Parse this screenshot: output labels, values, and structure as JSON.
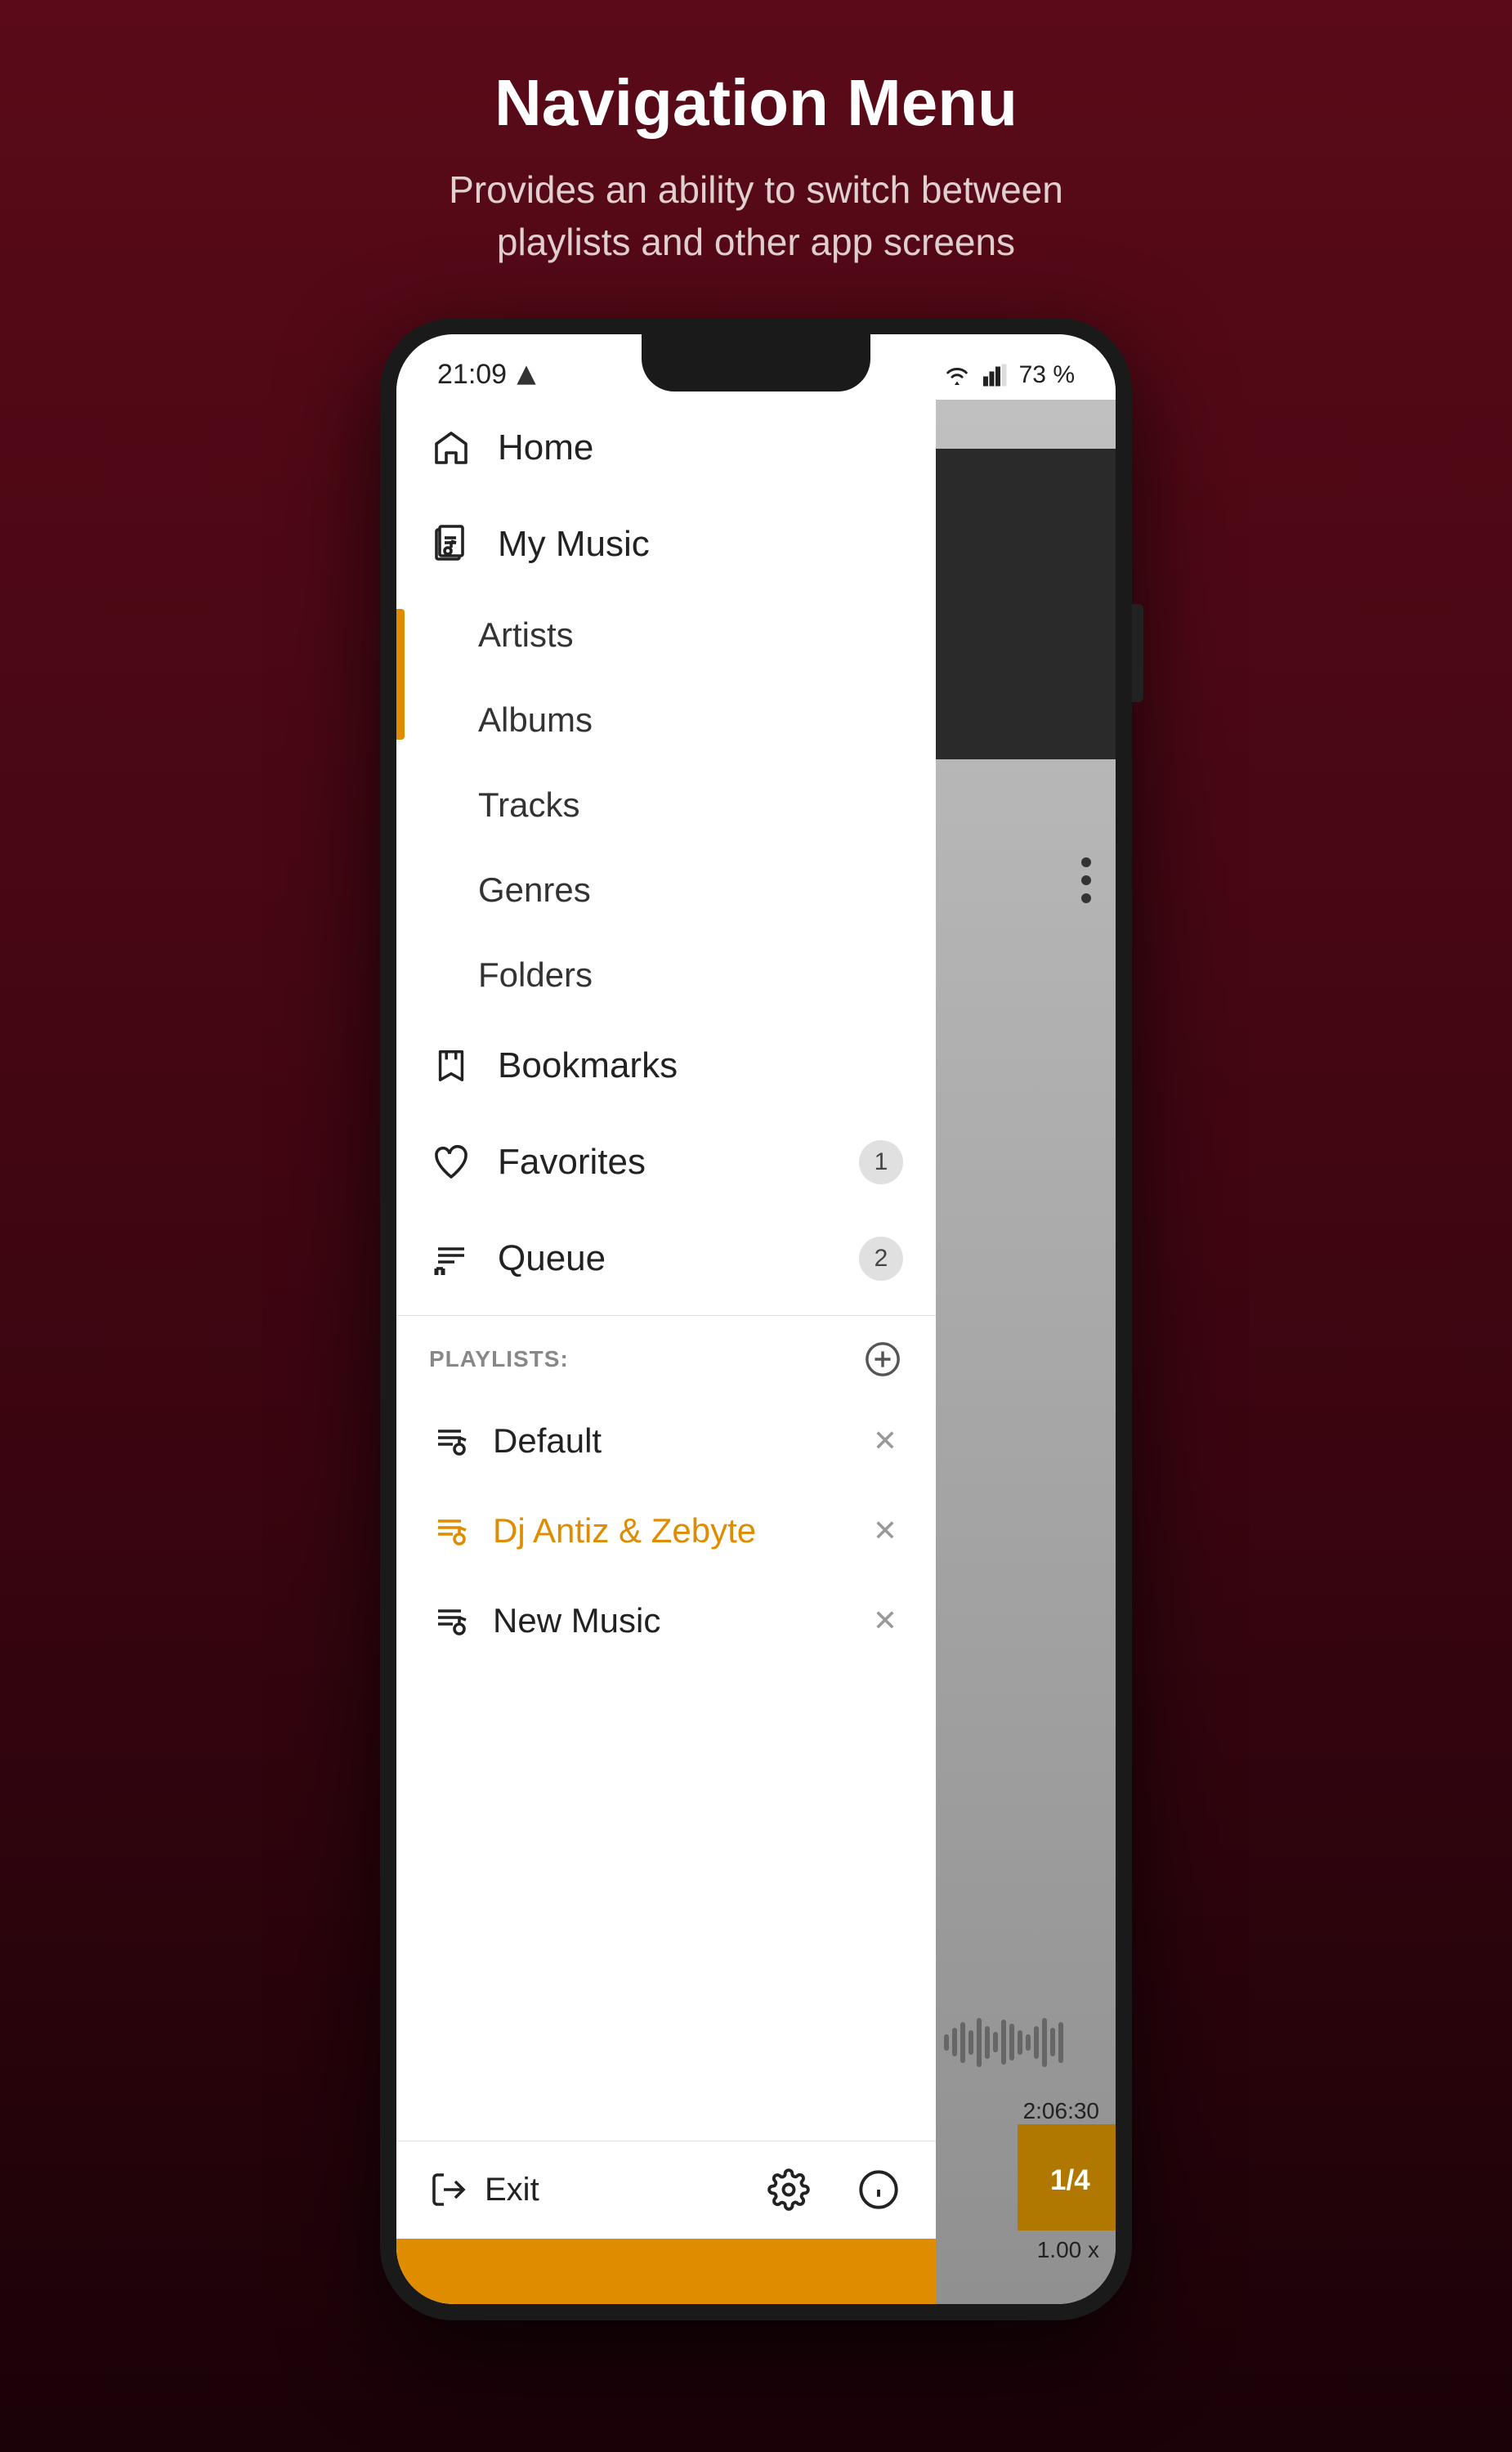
{
  "header": {
    "title": "Navigation Menu",
    "subtitle": "Provides an ability to switch between\nplaylists and other app screens"
  },
  "status_bar": {
    "time": "21:09",
    "battery": "73 %"
  },
  "nav_items": [
    {
      "id": "home",
      "label": "Home",
      "icon": "home-icon",
      "badge": null,
      "active": false
    },
    {
      "id": "my-music",
      "label": "My Music",
      "icon": "music-library-icon",
      "badge": null,
      "active": true
    }
  ],
  "sub_items": [
    {
      "id": "artists",
      "label": "Artists"
    },
    {
      "id": "albums",
      "label": "Albums"
    },
    {
      "id": "tracks",
      "label": "Tracks"
    },
    {
      "id": "genres",
      "label": "Genres"
    },
    {
      "id": "folders",
      "label": "Folders"
    }
  ],
  "nav_items_bottom": [
    {
      "id": "bookmarks",
      "label": "Bookmarks",
      "icon": "bookmark-icon",
      "badge": null
    },
    {
      "id": "favorites",
      "label": "Favorites",
      "icon": "heart-icon",
      "badge": "1"
    },
    {
      "id": "queue",
      "label": "Queue",
      "icon": "queue-icon",
      "badge": "2"
    }
  ],
  "playlists_label": "PLAYLISTS:",
  "playlists": [
    {
      "id": "default",
      "label": "Default",
      "active": false
    },
    {
      "id": "dj-antiz",
      "label": "Dj Antiz & Zebyte",
      "active": true
    },
    {
      "id": "new-music",
      "label": "New Music",
      "active": false
    }
  ],
  "bottom_bar": {
    "exit_label": "Exit",
    "settings_icon": "settings-icon",
    "info_icon": "info-icon"
  },
  "content_right": {
    "time": "2:06:30",
    "speed": "1.00 x"
  }
}
